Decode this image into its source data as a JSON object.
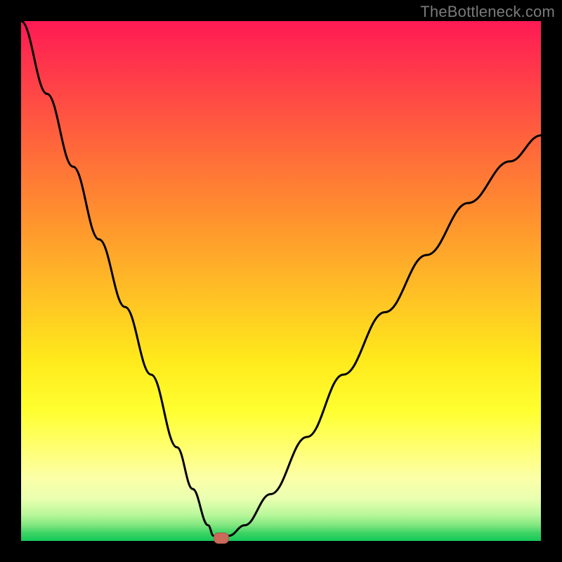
{
  "attribution": "TheBottleneck.com",
  "colors": {
    "frame": "#000000",
    "curve": "#000000",
    "marker": "#c96a5a"
  },
  "chart_data": {
    "type": "line",
    "title": "",
    "xlabel": "",
    "ylabel": "",
    "xlim": [
      0,
      100
    ],
    "ylim": [
      0,
      100
    ],
    "series": [
      {
        "name": "bottleneck-curve",
        "x": [
          0,
          5,
          10,
          15,
          20,
          25,
          30,
          33,
          36,
          37,
          38,
          39,
          40,
          43,
          48,
          55,
          62,
          70,
          78,
          86,
          94,
          100
        ],
        "values": [
          100,
          86,
          72,
          58,
          45,
          32,
          18,
          10,
          3,
          1,
          0,
          0,
          1,
          3,
          9,
          20,
          32,
          44,
          55,
          65,
          73,
          78
        ]
      }
    ],
    "annotations": [
      {
        "name": "optimal-marker",
        "x": 38.5,
        "y": 0
      }
    ],
    "legend": false,
    "grid": false
  }
}
